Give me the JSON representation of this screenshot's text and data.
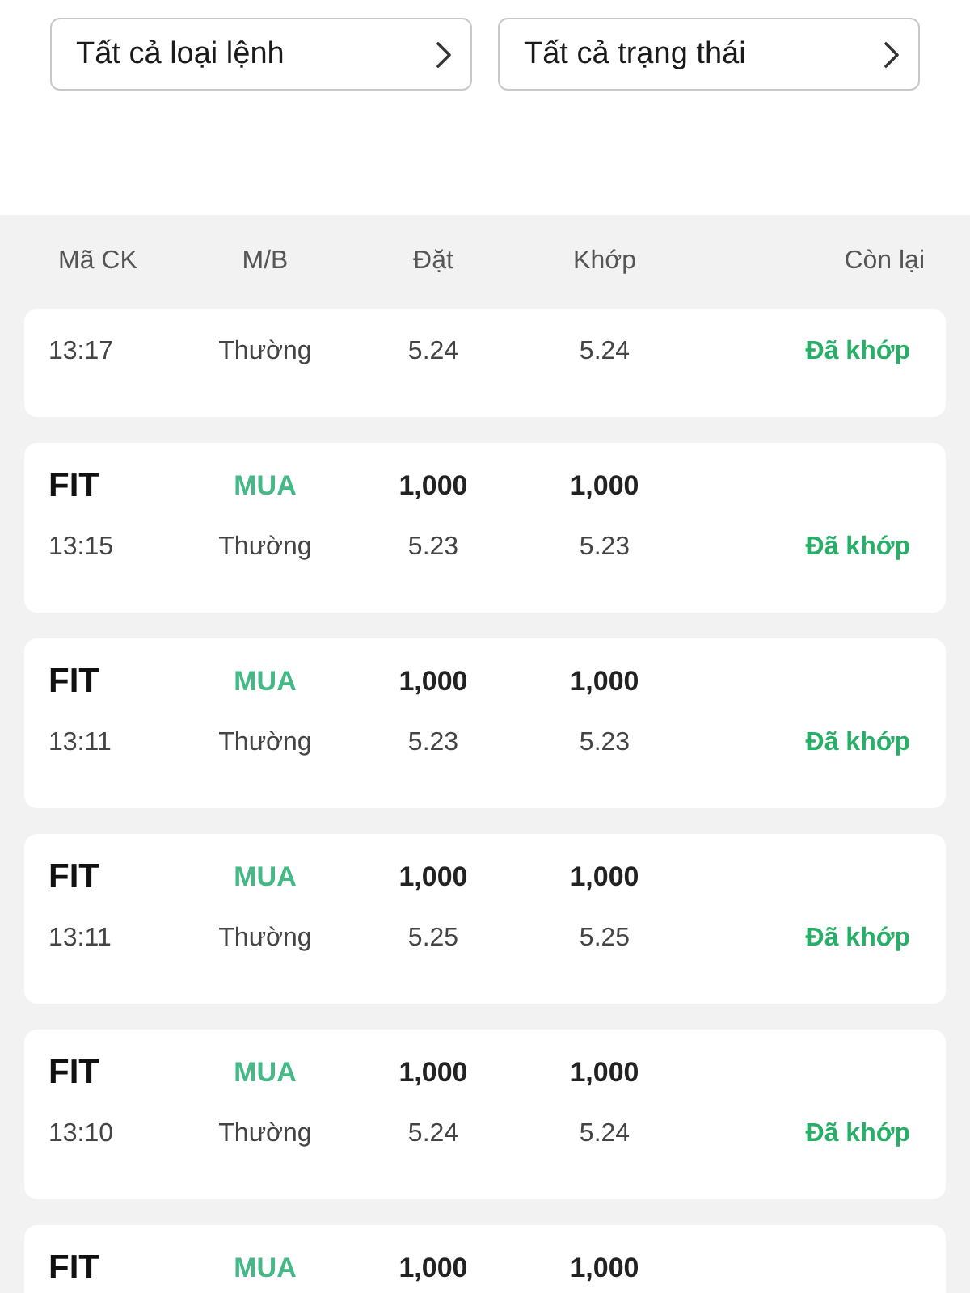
{
  "filters": [
    {
      "label": "Tất cả loại lệnh"
    },
    {
      "label": "Tất cả trạng thái"
    }
  ],
  "table": {
    "columns": [
      "Mã CK",
      "M/B",
      "Đặt",
      "Khớp",
      "Còn lại"
    ]
  },
  "orders": [
    {
      "time": "13:17",
      "order_type": "Thường",
      "price": "5.24",
      "matched_price": "5.24",
      "status": {
        "label": "Đã khớp",
        "kind": "matched"
      }
    },
    {
      "symbol": "FIT",
      "side": {
        "label": "MUA",
        "kind": "buy"
      },
      "quantity": "1,000",
      "matched_quantity": "1,000",
      "time": "13:15",
      "order_type": "Thường",
      "price": "5.23",
      "matched_price": "5.23",
      "status": {
        "label": "Đã khớp",
        "kind": "matched"
      }
    },
    {
      "symbol": "FIT",
      "side": {
        "label": "MUA",
        "kind": "buy"
      },
      "quantity": "1,000",
      "matched_quantity": "1,000",
      "time": "13:11",
      "order_type": "Thường",
      "price": "5.23",
      "matched_price": "5.23",
      "status": {
        "label": "Đã khớp",
        "kind": "matched"
      }
    },
    {
      "symbol": "FIT",
      "side": {
        "label": "MUA",
        "kind": "buy"
      },
      "quantity": "1,000",
      "matched_quantity": "1,000",
      "time": "13:11",
      "order_type": "Thường",
      "price": "5.25",
      "matched_price": "5.25",
      "status": {
        "label": "Đã khớp",
        "kind": "matched"
      }
    },
    {
      "symbol": "FIT",
      "side": {
        "label": "MUA",
        "kind": "buy"
      },
      "quantity": "1,000",
      "matched_quantity": "1,000",
      "time": "13:10",
      "order_type": "Thường",
      "price": "5.24",
      "matched_price": "5.24",
      "status": {
        "label": "Đã khớp",
        "kind": "matched"
      }
    },
    {
      "symbol": "FIT",
      "side": {
        "label": "MUA",
        "kind": "buy"
      },
      "quantity": "1,000",
      "matched_quantity": "1,000"
    }
  ]
}
